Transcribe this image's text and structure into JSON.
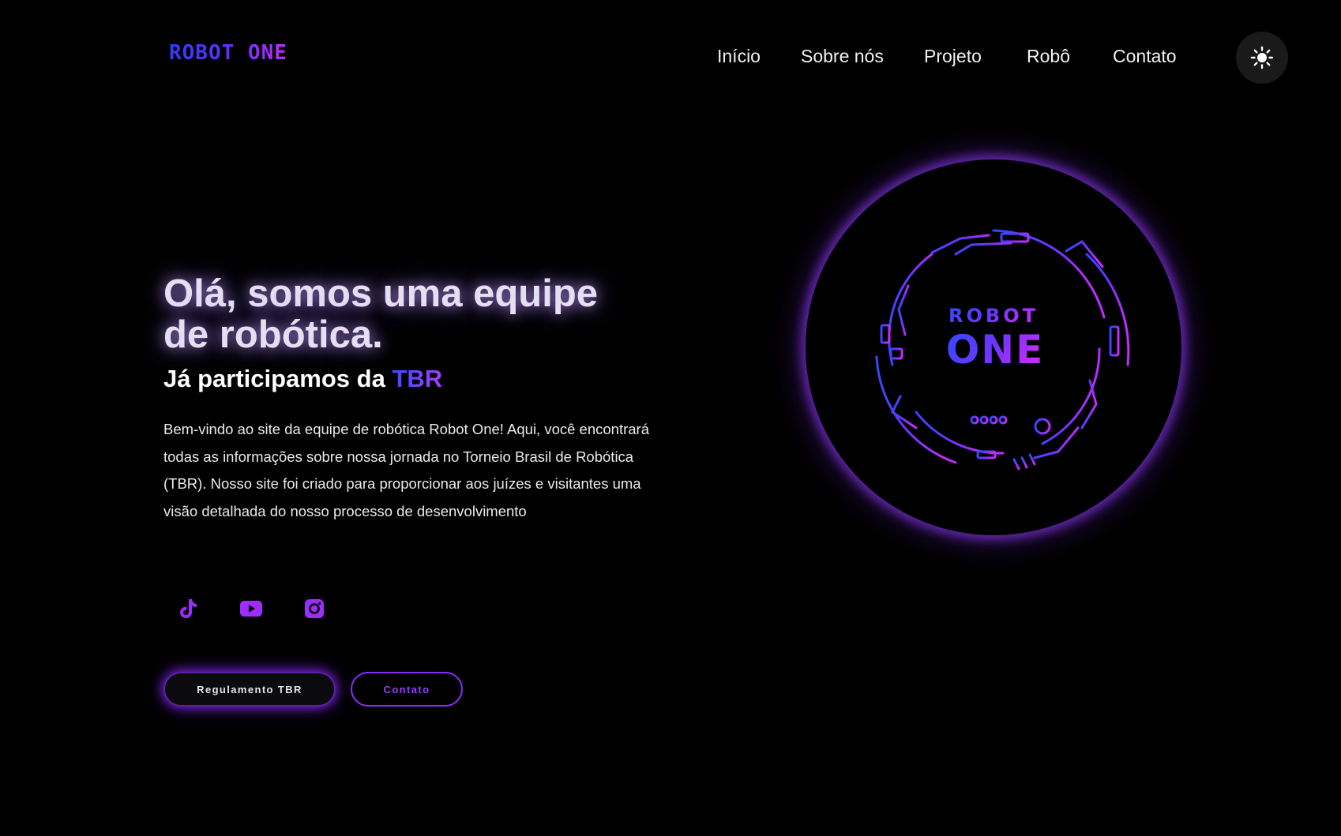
{
  "header": {
    "logo": "ROBOT ONE",
    "nav": [
      "Início",
      "Sobre nós",
      "Projeto",
      "Robô",
      "Contato"
    ],
    "theme_toggle_icon": "sun-icon"
  },
  "hero": {
    "headline": "Olá, somos uma equipe de robótica.",
    "subhead_prefix": "Já participamos da",
    "subhead_highlight": "TBR",
    "intro": "Bem-vindo ao site da equipe de robótica Robot One! Aqui, você encontrará todas as informações sobre nossa jornada no Torneio Brasil de Robótica (TBR). Nosso site foi criado para proporcionar aos juízes e visitantes uma visão detalhada do nosso processo de desenvolvimento",
    "socials": [
      "tiktok-icon",
      "youtube-icon",
      "instagram-icon"
    ],
    "buttons": {
      "primary": "Regulamento TBR",
      "secondary": "Contato"
    }
  },
  "emblem": {
    "line1": "ROBOT",
    "line2": "ONE"
  },
  "colors": {
    "background": "#000000",
    "accent_blue": "#2f3cff",
    "accent_purple": "#9a3dff",
    "glow": "#8c28ff"
  }
}
